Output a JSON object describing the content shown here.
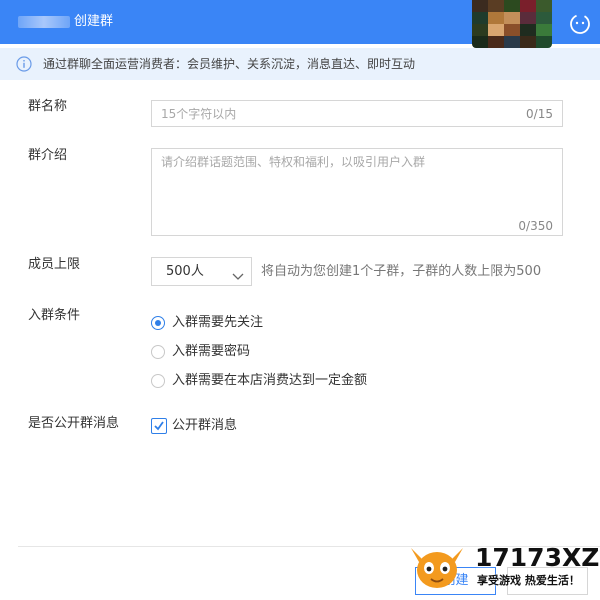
{
  "window": {
    "title": "创建群",
    "help_icon": "question-circle-icon"
  },
  "info_bar": {
    "icon": "info-circle-icon",
    "text": "通过群聊全面运营消费者：会员维护、关系沉淀，消息直达、即时互动"
  },
  "form": {
    "name": {
      "label": "群名称",
      "placeholder": "15个字符以内",
      "counter": "0/15"
    },
    "intro": {
      "label": "群介绍",
      "placeholder": "请介绍群话题范围、特权和福利，以吸引用户入群",
      "counter": "0/350"
    },
    "member_limit": {
      "label": "成员上限",
      "selected": "500人",
      "hint": "将自动为您创建1个子群，子群的人数上限为500"
    },
    "join_condition": {
      "label": "入群条件",
      "options": [
        {
          "label": "入群需要先关注",
          "checked": true
        },
        {
          "label": "入群需要密码",
          "checked": false
        },
        {
          "label": "入群需要在本店消费达到一定金额",
          "checked": false
        }
      ]
    },
    "public_messages": {
      "label": "是否公开群消息",
      "checkbox_label": "公开群消息",
      "checked": true
    }
  },
  "footer": {
    "create_label": "创建"
  },
  "watermark": {
    "name": "17173XZ",
    "slogan": "享受游戏 热爱生活！"
  },
  "colors": {
    "accent": "#3a85f6",
    "info_bg": "#e9f2fd",
    "watermark_orange": "#f39a1e"
  }
}
